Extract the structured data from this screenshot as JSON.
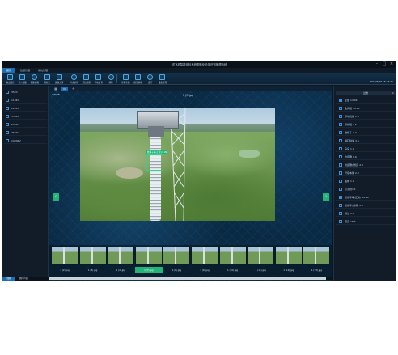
{
  "window": {
    "title": "送飞机智能巡检系统图形化检测识别管理系统",
    "controls": [
      "–",
      "□",
      "×"
    ]
  },
  "menu": {
    "tabs": [
      "首页",
      "数据管理",
      "系统管理"
    ],
    "active_index": 0
  },
  "toolbar": {
    "tools": [
      {
        "label": "输出图片",
        "icon": "export-image-icon"
      },
      {
        "label": "导入图像",
        "icon": "import-image-icon"
      },
      {
        "label": "图像编辑",
        "icon": "edit-image-icon"
      },
      {
        "label": "画标记",
        "icon": "draw-mark-icon"
      },
      {
        "label": "图像上传",
        "icon": "upload-icon"
      },
      {
        "label": "异步识别",
        "icon": "async-detect-icon"
      },
      {
        "label": "开始预测",
        "icon": "predict-icon"
      },
      {
        "label": "手动复查",
        "icon": "manual-review-icon"
      },
      {
        "label": "清除",
        "icon": "clear-icon"
      },
      {
        "label": "查看准确",
        "icon": "accuracy-icon"
      },
      {
        "label": "模型训练",
        "icon": "train-icon"
      },
      {
        "label": "运行",
        "icon": "run-icon"
      },
      {
        "label": "设备管理",
        "icon": "device-icon"
      }
    ],
    "datetime": "2019/6/25 15:46:41"
  },
  "left_panel": {
    "items": [
      {
        "label": "35KV"
      },
      {
        "label": "110KV"
      },
      {
        "label": "220KV"
      },
      {
        "label": "330KV"
      },
      {
        "label": "500KV"
      },
      {
        "label": "750KV"
      },
      {
        "label": "1000KV"
      }
    ],
    "footer_tabs": [
      "线路",
      "图片列表"
    ]
  },
  "viewer": {
    "view_buttons": [
      {
        "icon": "grid-view-icon",
        "glyph": "▦"
      },
      {
        "icon": "image-view-icon",
        "glyph": "▭"
      },
      {
        "icon": "drone-icon",
        "glyph": "✈"
      }
    ],
    "counter": "1/8/48",
    "image_title": "1 (7).jpg",
    "detection_label": "绝缘子串(正常) 0.99",
    "prev_arrow": "‹",
    "next_arrow": "›"
  },
  "thumbnails": [
    {
      "label": "1 (2).jpg"
    },
    {
      "label": "1 (3).jpg"
    },
    {
      "label": "1 (4).jpg"
    },
    {
      "label": "1 (7).jpg",
      "active": true
    },
    {
      "label": "1 (8).jpg"
    },
    {
      "label": "1 (9).jpg"
    },
    {
      "label": "1 (10).jpg"
    },
    {
      "label": "1 (11).jpg"
    },
    {
      "label": "1 (12).jpg"
    },
    {
      "label": "1 (13).jpg"
    }
  ],
  "right_panel": {
    "header": "过滤",
    "close": "×",
    "items": [
      {
        "label": "全部 14.04",
        "checked": true
      },
      {
        "label": "金具组 14.04"
      },
      {
        "label": "导地线组 2.5"
      },
      {
        "label": "导线组 2.5"
      },
      {
        "label": "绝缘子 1.0"
      },
      {
        "label": "销钉缺失 3.6"
      },
      {
        "label": "鸟窝 1.0"
      },
      {
        "label": "防震锤 0.6"
      },
      {
        "label": "防震锤(破损) 2.0"
      },
      {
        "label": "杆塔本体 2.0"
      },
      {
        "label": "瓶帽 1.0"
      },
      {
        "label": "引流线1.1"
      },
      {
        "label": "绝缘子串(正常) 18.92",
        "checked": true
      },
      {
        "label": "绝缘子(自爆) 2.0"
      },
      {
        "label": "锈蚀 1.0"
      },
      {
        "label": "塔身 18.6"
      }
    ]
  },
  "colors": {
    "accent_blue": "#1e6db1",
    "accent_green": "#23b478",
    "background": "#0d1722"
  }
}
